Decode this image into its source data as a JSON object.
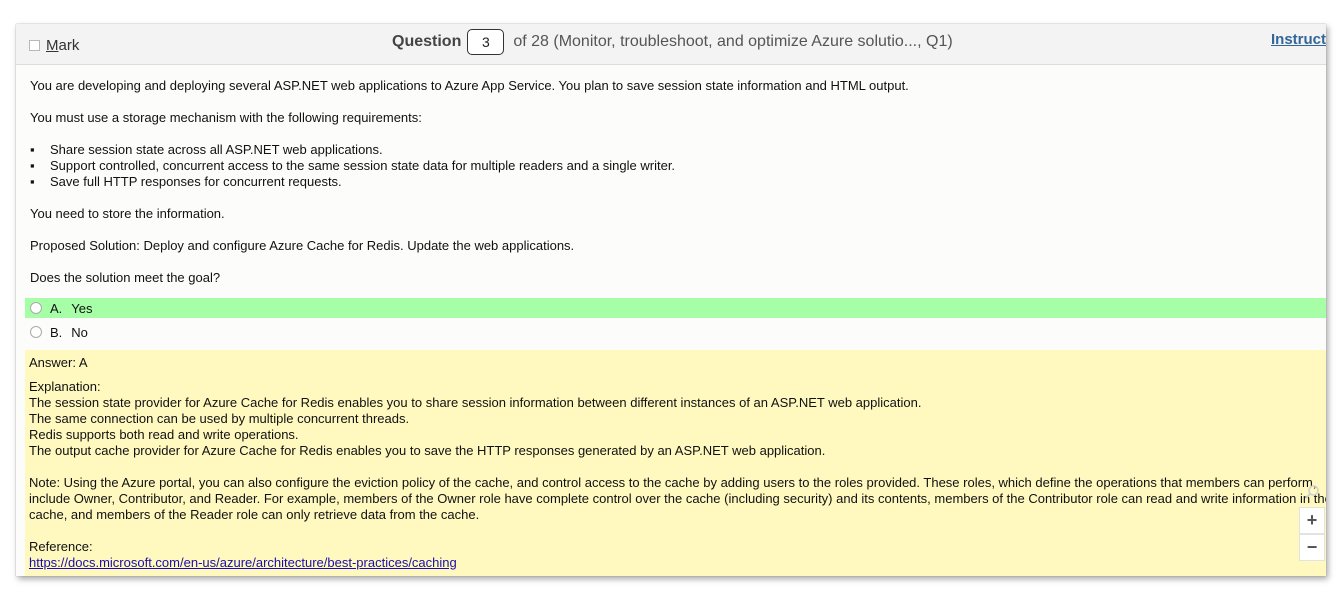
{
  "header": {
    "mark_prefix": "",
    "mark_underlined": "M",
    "mark_rest": "ark",
    "question_label": "Question",
    "question_number": "3",
    "question_suffix": "of 28 (Monitor, troubleshoot, and optimize Azure solutio..., Q1)",
    "instructions_link": "Instructions"
  },
  "question": {
    "intro": "You are developing and deploying several ASP.NET web applications to Azure App Service. You plan to save session state information and HTML output.",
    "requirements_intro": "You must use a storage mechanism with the following requirements:",
    "requirements": [
      "Share session state across all ASP.NET web applications.",
      "Support controlled, concurrent access to the same session state data for multiple readers and a single writer.",
      "Save full HTTP responses for concurrent requests."
    ],
    "need": "You need to store the information.",
    "proposed": "Proposed Solution: Deploy and configure Azure Cache for Redis. Update the web applications.",
    "prompt": "Does the solution meet the goal?"
  },
  "options": [
    {
      "letter": "A.",
      "text": "Yes",
      "selected": true
    },
    {
      "letter": "B.",
      "text": "No",
      "selected": false
    }
  ],
  "answer": {
    "answer_line": "Answer: A",
    "explanation_label": "Explanation:",
    "explanation_lines": [
      "The session state provider for Azure Cache for Redis enables you to share session information between different instances of an ASP.NET web application.",
      "The same connection can be used by multiple concurrent threads.",
      "Redis supports both read and write operations.",
      "The output cache provider for Azure Cache for Redis enables you to save the HTTP responses generated by an ASP.NET web application."
    ],
    "note_lines": [
      "Note: Using the Azure portal, you can also configure the eviction policy of the cache, and control access to the cache by adding users to the roles provided. These roles, which define the operations that members can perform,",
      "include Owner, Contributor, and Reader. For example, members of the Owner role have complete control over the cache (including security) and its contents, members of the Contributor role can read and write information in the",
      "cache, and members of the Reader role can only retrieve data from the cache."
    ],
    "reference_label": "Reference:",
    "reference_url": "https://docs.microsoft.com/en-us/azure/architecture/best-practices/caching"
  },
  "zoom": {
    "zoom_in": "+",
    "zoom_out": "−",
    "magnifier_icon": "magnifier-icon"
  },
  "colors": {
    "selected_option_bg": "#a6ffa6",
    "answer_bg": "#fff9c0",
    "link": "#1a0dab"
  }
}
